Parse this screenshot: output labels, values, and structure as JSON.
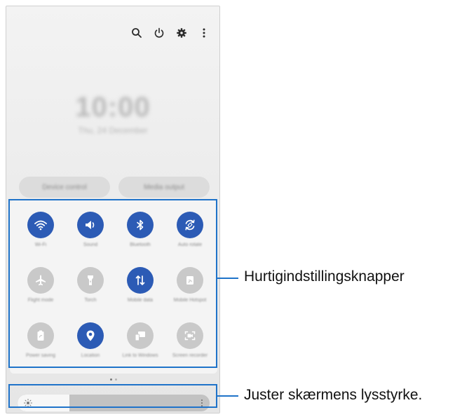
{
  "top_icons": [
    "search-icon",
    "power-icon",
    "gear-icon",
    "more-vert-icon"
  ],
  "clock": {
    "time": "10:00",
    "date": "Thu, 24 December"
  },
  "pills": {
    "left": "Device control",
    "right": "Media output"
  },
  "tiles": [
    {
      "label": "Wi-Fi",
      "icon": "wifi-icon",
      "state": "on"
    },
    {
      "label": "Sound",
      "icon": "sound-icon",
      "state": "on"
    },
    {
      "label": "Bluetooth",
      "icon": "bluetooth-icon",
      "state": "on"
    },
    {
      "label": "Auto rotate",
      "icon": "auto-rotate-icon",
      "state": "on"
    },
    {
      "label": "Flight mode",
      "icon": "airplane-icon",
      "state": "off"
    },
    {
      "label": "Torch",
      "icon": "flashlight-icon",
      "state": "off"
    },
    {
      "label": "Mobile data",
      "icon": "mobile-data-icon",
      "state": "on"
    },
    {
      "label": "Mobile Hotspot",
      "icon": "hotspot-icon",
      "state": "off"
    },
    {
      "label": "Power saving",
      "icon": "battery-icon",
      "state": "off"
    },
    {
      "label": "Location",
      "icon": "location-icon",
      "state": "on"
    },
    {
      "label": "Link to Windows",
      "icon": "link-windows-icon",
      "state": "off"
    },
    {
      "label": "Screen recorder",
      "icon": "screen-recorder-icon",
      "state": "off"
    }
  ],
  "brightness": {
    "level_percent": 27
  },
  "callouts": {
    "quick_settings": "Hurtigindstillingsknapper",
    "brightness": "Juster skærmens lysstyrke."
  },
  "colors": {
    "accent": "#2c5bb5",
    "callout": "#1f73c9",
    "tile_off": "#c9c9c9"
  }
}
